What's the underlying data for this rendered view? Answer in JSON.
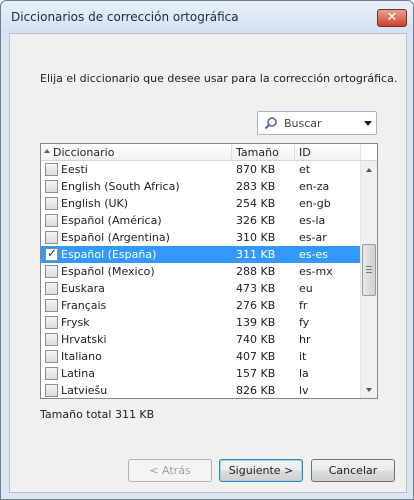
{
  "window": {
    "title": "Diccionarios de corrección ortográfica",
    "close_glyph": "✕"
  },
  "instruction": "Elija el diccionario que desee usar para la corrección ortográfica.",
  "search": {
    "placeholder": "Buscar",
    "icon": "search-icon"
  },
  "table": {
    "columns": [
      "Diccionario",
      "Tamaño",
      "ID"
    ],
    "rows": [
      {
        "name": "Eesti",
        "size": "870 KB",
        "id": "et",
        "checked": false
      },
      {
        "name": "English (South Africa)",
        "size": "283 KB",
        "id": "en-za",
        "checked": false
      },
      {
        "name": "English (UK)",
        "size": "254 KB",
        "id": "en-gb",
        "checked": false
      },
      {
        "name": "Español (América)",
        "size": "326 KB",
        "id": "es-la",
        "checked": false
      },
      {
        "name": "Español (Argentina)",
        "size": "310 KB",
        "id": "es-ar",
        "checked": false
      },
      {
        "name": "Español (España)",
        "size": "311 KB",
        "id": "es-es",
        "checked": true,
        "selected": true
      },
      {
        "name": "Español (Mexico)",
        "size": "288 KB",
        "id": "es-mx",
        "checked": false
      },
      {
        "name": "Euskara",
        "size": "473 KB",
        "id": "eu",
        "checked": false
      },
      {
        "name": "Français",
        "size": "276 KB",
        "id": "fr",
        "checked": false
      },
      {
        "name": "Frysk",
        "size": "139 KB",
        "id": "fy",
        "checked": false
      },
      {
        "name": "Hrvatski",
        "size": "740 KB",
        "id": "hr",
        "checked": false
      },
      {
        "name": "Italiano",
        "size": "407 KB",
        "id": "it",
        "checked": false
      },
      {
        "name": "Latina",
        "size": "157 KB",
        "id": "la",
        "checked": false
      },
      {
        "name": "Latviešu",
        "size": "826 KB",
        "id": "lv",
        "checked": false
      }
    ]
  },
  "total_label": "Tamaño total 311 KB",
  "buttons": {
    "back": "< Atrás",
    "next": "Siguiente >",
    "cancel": "Cancelar"
  },
  "colors": {
    "selection": "#3399ff",
    "frame": "#dbe6f2",
    "close_button": "#c8412b"
  }
}
